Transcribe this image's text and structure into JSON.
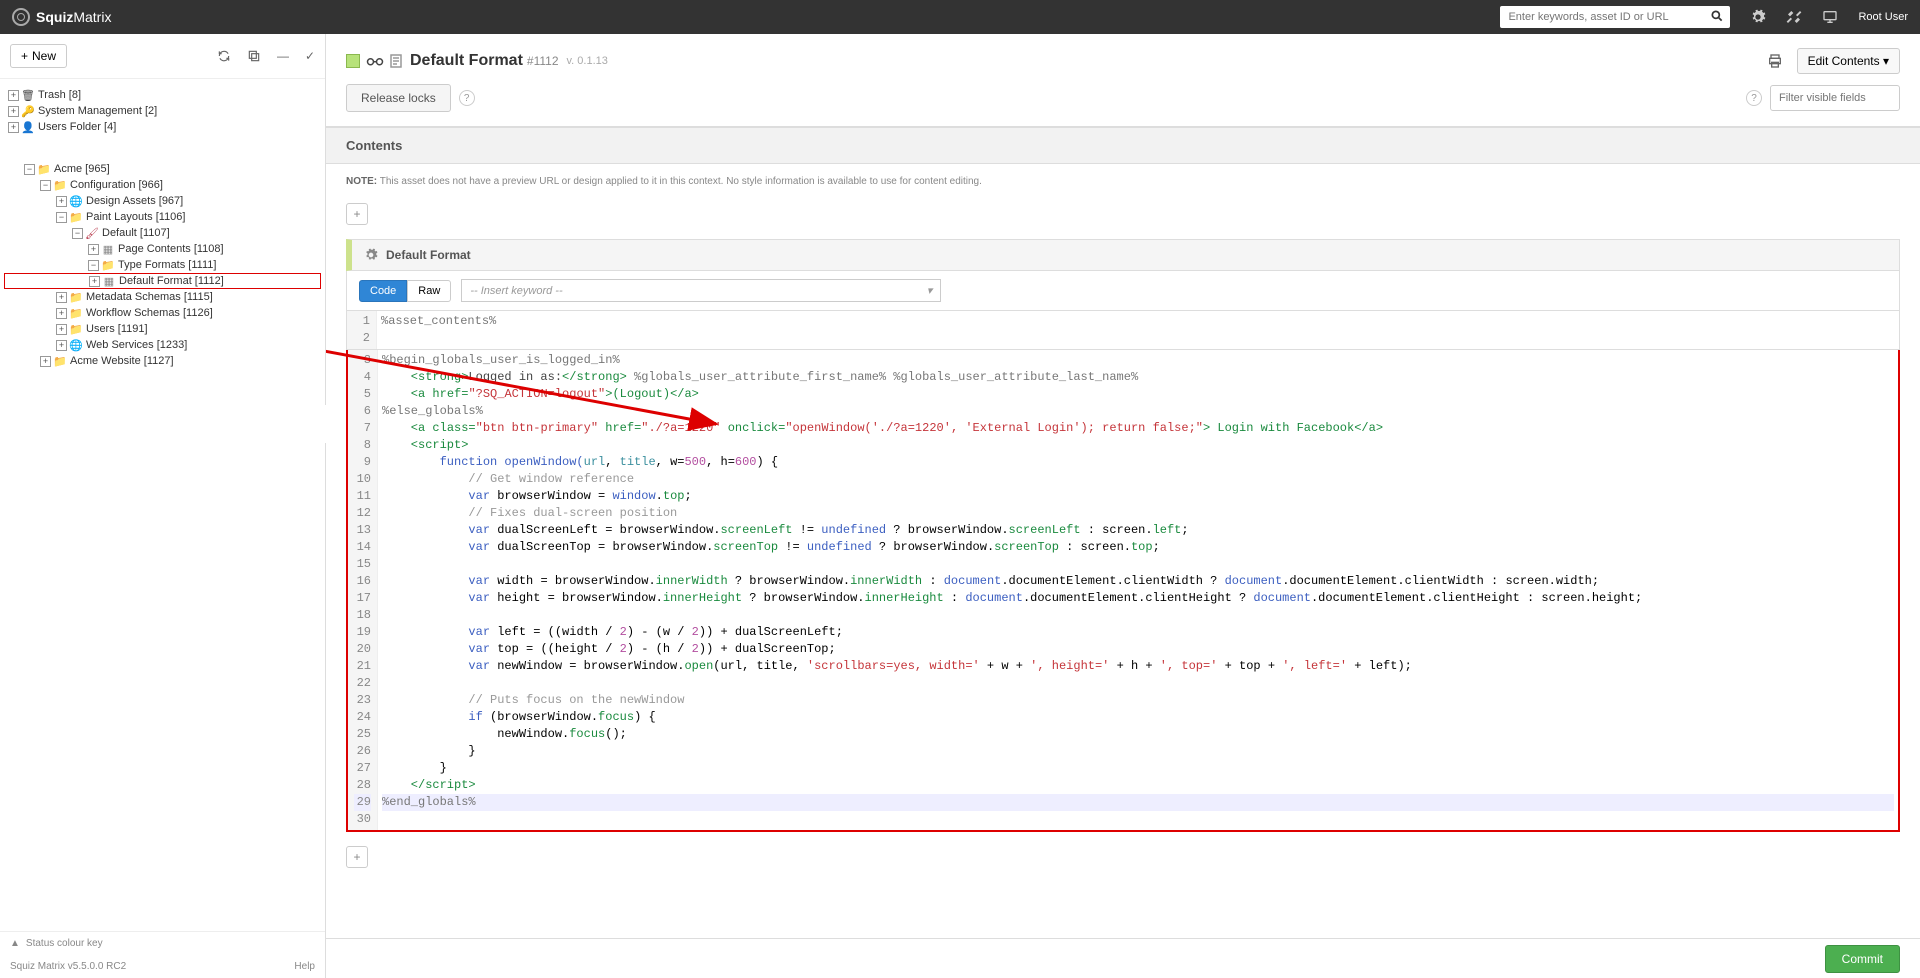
{
  "header": {
    "brand_bold": "Squiz",
    "brand_thin": "Matrix",
    "search_placeholder": "Enter keywords, asset ID or URL",
    "username": "Root User"
  },
  "sidebar": {
    "new_btn": "New",
    "status_key": "Status colour key",
    "version": "Squiz Matrix v5.5.0.0 RC2",
    "help": "Help"
  },
  "tree": {
    "trash": "Trash [8]",
    "sysmgmt": "System Management [2]",
    "users_folder": "Users Folder [4]",
    "acme": "Acme [965]",
    "config": "Configuration [966]",
    "design": "Design Assets [967]",
    "paint": "Paint Layouts [1106]",
    "default_pl": "Default [1107]",
    "page_contents": "Page Contents [1108]",
    "type_formats": "Type Formats [1111]",
    "default_format": "Default Format [1112]",
    "metadata": "Metadata Schemas [1115]",
    "workflow": "Workflow Schemas [1126]",
    "users": "Users [1191]",
    "webservices": "Web Services [1233]",
    "acme_site": "Acme Website [1127]"
  },
  "asset": {
    "title": "Default Format",
    "id": "#1112",
    "version": "v. 0.1.13",
    "edit_btn": "Edit Contents ▾",
    "release": "Release locks",
    "filter_placeholder": "Filter visible fields",
    "section": "Contents",
    "note_label": "NOTE:",
    "note_text": "This asset does not have a preview URL or design applied to it in this context. No style information is available to use for content editing.",
    "block_title": "Default Format",
    "tab_code": "Code",
    "tab_raw": "Raw",
    "keyword_placeholder": "-- Insert keyword --",
    "commit": "Commit"
  },
  "code": {
    "line1": "%asset_contents%",
    "line3": "%begin_globals_user_is_logged_in%",
    "line4_a": "    <strong>",
    "line4_b": "Logged in as:",
    "line4_c": "</strong>",
    "line4_d": " %globals_user_attribute_first_name% %globals_user_attribute_last_name%",
    "line5_a": "    <a ",
    "line5_b": "href=",
    "line5_c": "\"?SQ_ACTION=logout\"",
    "line5_d": ">(Logout)</a>",
    "line6": "%else_globals%",
    "line7_a": "    <a ",
    "line7_b": "class=",
    "line7_c": "\"btn btn-primary\"",
    "line7_d": " href=",
    "line7_e": "\"./?a=1220\"",
    "line7_f": " onclick=",
    "line7_g": "\"openWindow('./?a=1220', 'External Login'); return false;\"",
    "line7_h": "> Login with Facebook</a>",
    "line8": "    <script>",
    "line9_a": "        function",
    "line9_b": " openWindow(",
    "line9_c": "url",
    "line9_d": ", ",
    "line9_e": "title",
    "line9_f": ", w=",
    "line9_g": "500",
    "line9_h": ", h=",
    "line9_i": "600",
    "line9_j": ") {",
    "line10": "            // Get window reference",
    "line11_a": "            var",
    "line11_b": " browserWindow = ",
    "line11_c": "window",
    "line11_d": ".",
    "line11_e": "top",
    "line11_f": ";",
    "line12": "            // Fixes dual-screen position",
    "line13": "            var dualScreenLeft = browserWindow.screenLeft != undefined ? browserWindow.screenLeft : screen.left;",
    "line14": "            var dualScreenTop = browserWindow.screenTop != undefined ? browserWindow.screenTop : screen.top;",
    "line16": "            var width = browserWindow.innerWidth ? browserWindow.innerWidth : document.documentElement.clientWidth ? document.documentElement.clientWidth : screen.width;",
    "line17": "            var height = browserWindow.innerHeight ? browserWindow.innerHeight : document.documentElement.clientHeight ? document.documentElement.clientHeight : screen.height;",
    "line19": "            var left = ((width / 2) - (w / 2)) + dualScreenLeft;",
    "line20": "            var top = ((height / 2) - (h / 2)) + dualScreenTop;",
    "line21": "            var newWindow = browserWindow.open(url, title, 'scrollbars=yes, width=' + w + ', height=' + h + ', top=' + top + ', left=' + left);",
    "line23": "            // Puts focus on the newWindow",
    "line24": "            if (browserWindow.focus) {",
    "line25": "                newWindow.focus();",
    "line26": "            }",
    "line27": "        }",
    "line28": "    </script>",
    "line29": "%end_globals%"
  }
}
